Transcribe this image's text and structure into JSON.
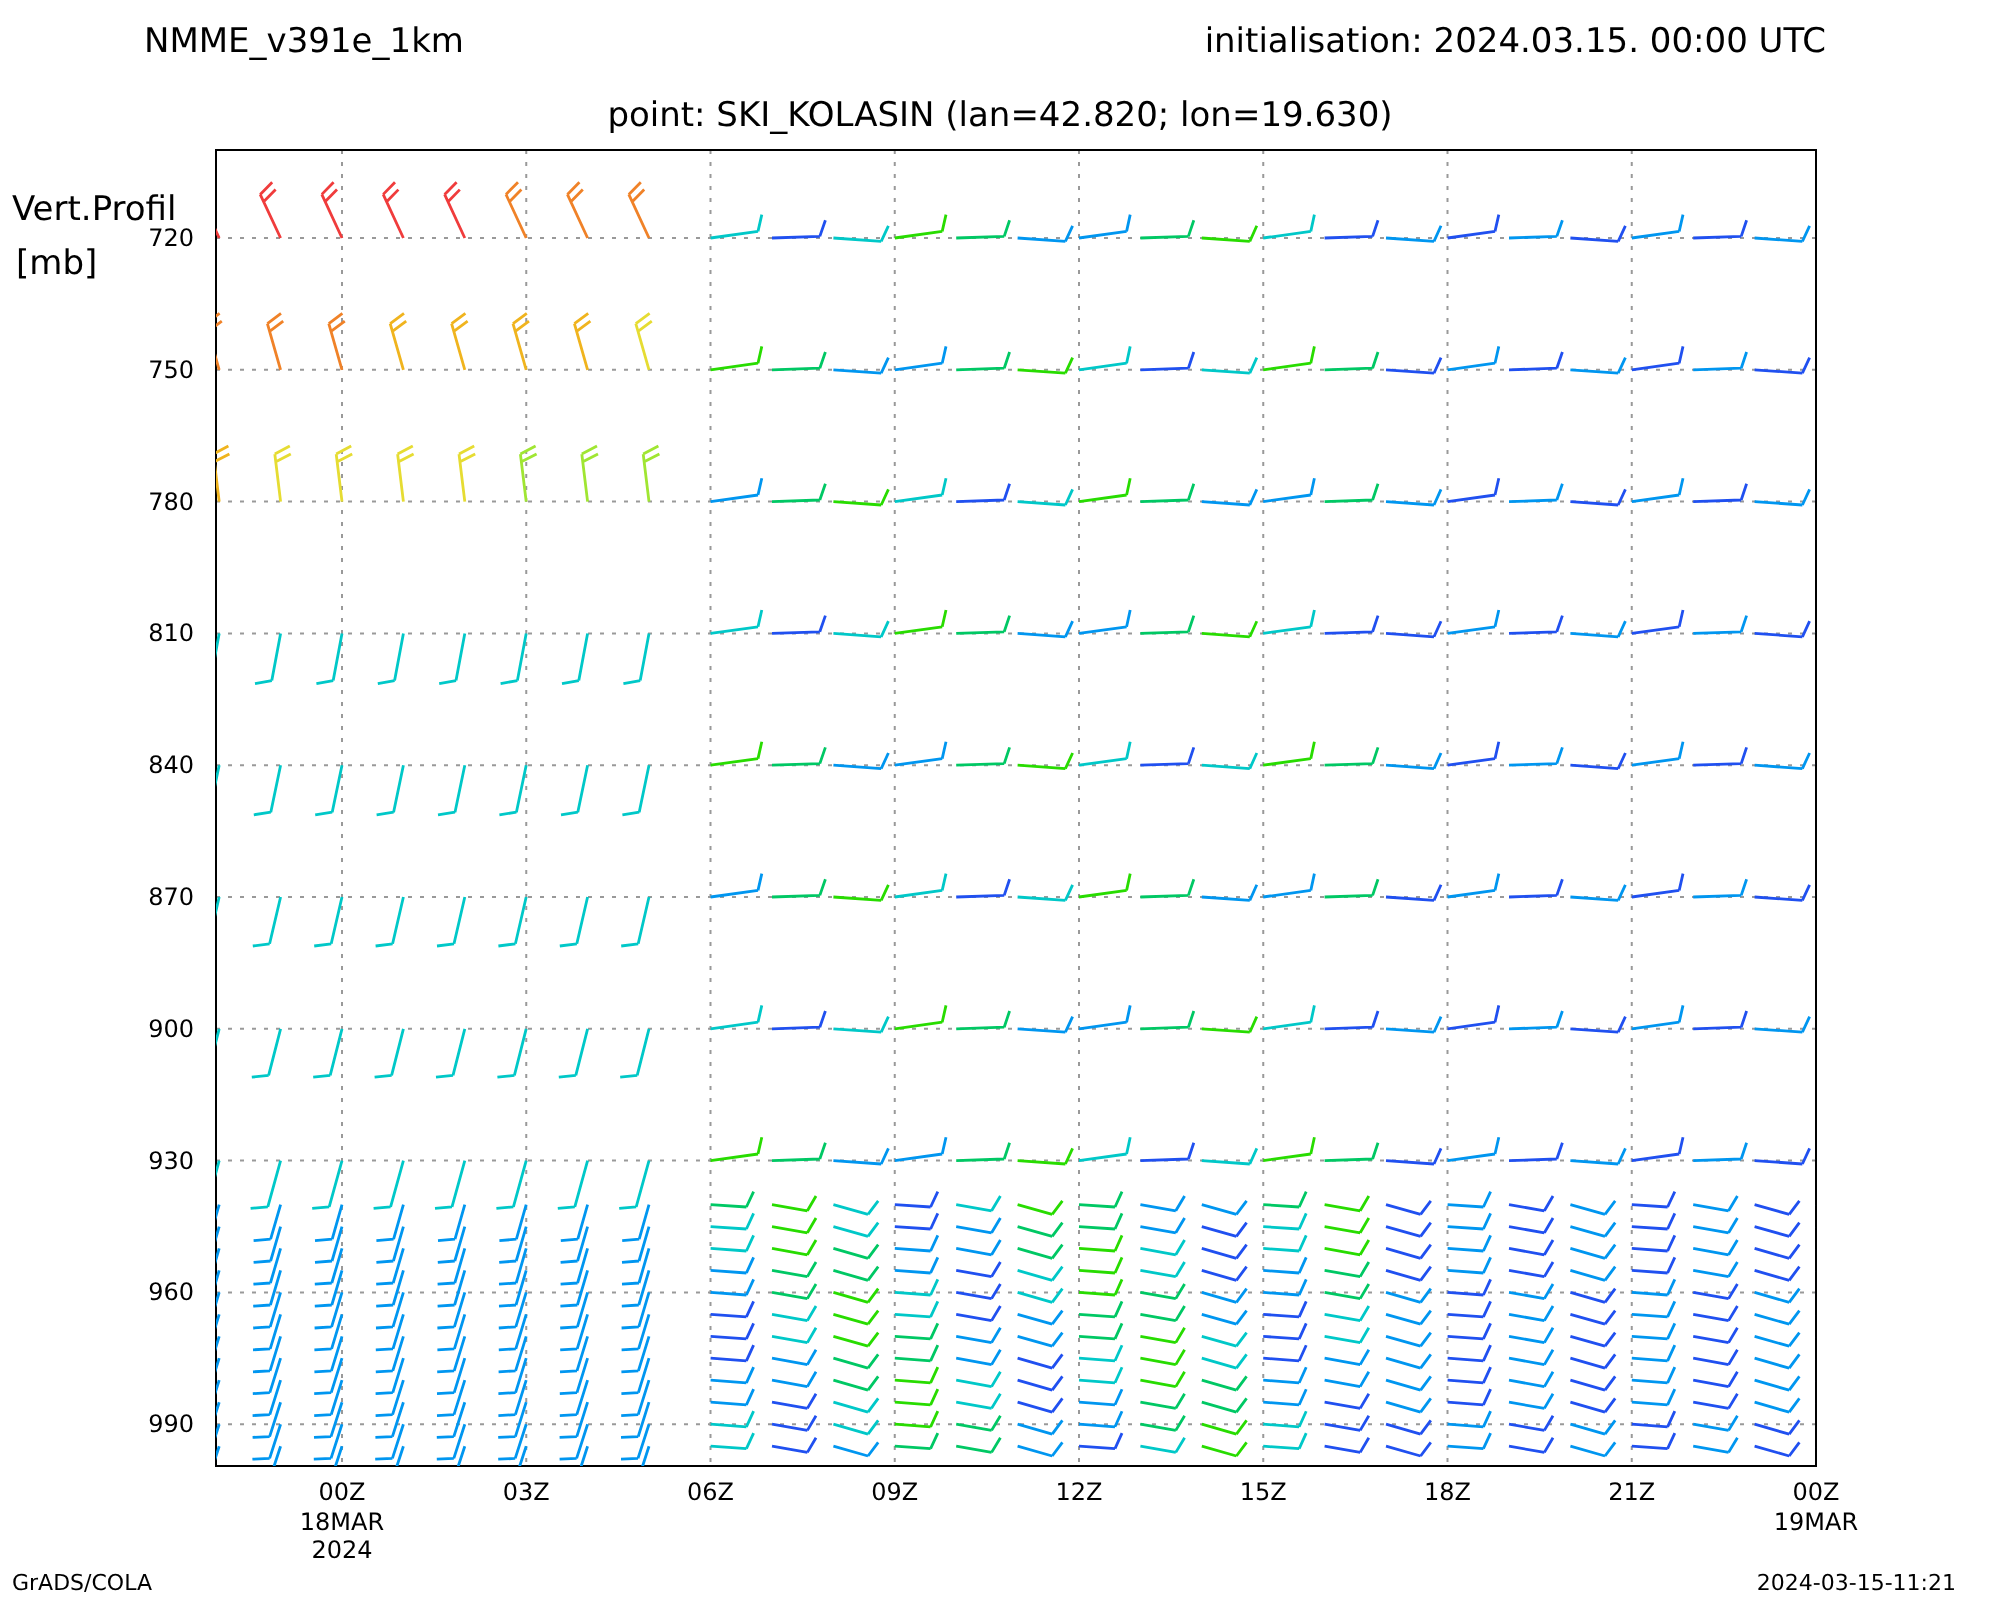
{
  "header": {
    "model": "NMME_v391e_1km",
    "initialisation": "initialisation: 2024.03.15. 00:00 UTC",
    "point": "point: SKI_KOLASIN (lan=42.820; lon=19.630)"
  },
  "plot": {
    "y_title": [
      "Vert.Profil",
      "[mb]"
    ],
    "y_ticks": [
      "720",
      "750",
      "780",
      "810",
      "840",
      "870",
      "900",
      "930",
      "960",
      "990"
    ],
    "x_ticks": [
      {
        "label": "00Z",
        "sub": [
          "18MAR",
          "2024"
        ]
      },
      {
        "label": "03Z"
      },
      {
        "label": "06Z"
      },
      {
        "label": "09Z"
      },
      {
        "label": "12Z"
      },
      {
        "label": "15Z"
      },
      {
        "label": "18Z"
      },
      {
        "label": "21Z"
      },
      {
        "label": "00Z",
        "sub": [
          "19MAR"
        ]
      }
    ]
  },
  "footer": {
    "software": "GrADS/COLA",
    "timestamp": "2024-03-15-11:21"
  }
}
